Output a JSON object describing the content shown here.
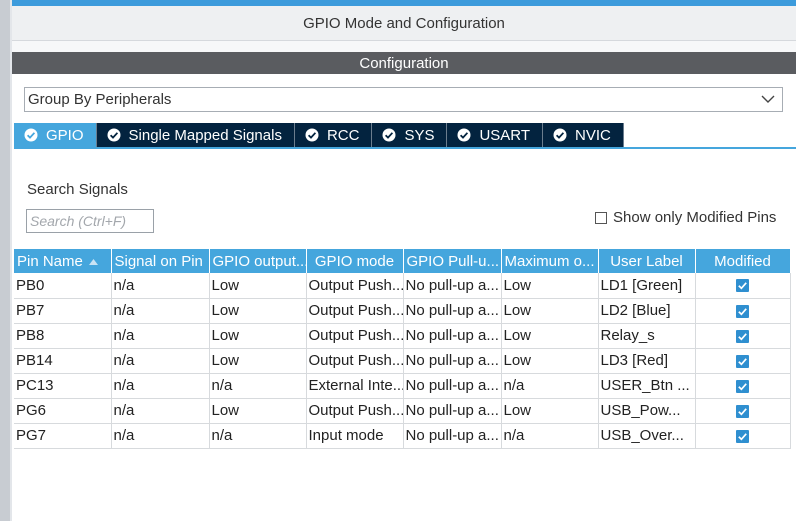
{
  "window": {
    "title": "GPIO Mode and Configuration"
  },
  "configuration": {
    "header": "Configuration",
    "group_select": {
      "value": "Group By Peripherals"
    }
  },
  "tabs": [
    {
      "label": "GPIO",
      "active": true
    },
    {
      "label": "Single Mapped Signals",
      "active": false
    },
    {
      "label": "RCC",
      "active": false
    },
    {
      "label": "SYS",
      "active": false
    },
    {
      "label": "USART",
      "active": false
    },
    {
      "label": "NVIC",
      "active": false
    }
  ],
  "search": {
    "label": "Search Signals",
    "placeholder": "Search (Ctrl+F)",
    "value": ""
  },
  "filter": {
    "label": "Show only Modified Pins",
    "checked": false
  },
  "table": {
    "columns": [
      "Pin Name",
      "Signal on Pin",
      "GPIO output...",
      "GPIO mode",
      "GPIO Pull-u...",
      "Maximum o...",
      "User Label",
      "Modified"
    ],
    "rows": [
      {
        "pin": "PB0",
        "signal": "n/a",
        "output": "Low",
        "mode": "Output Push...",
        "pull": "No pull-up a...",
        "speed": "Low",
        "label": "LD1 [Green]",
        "modified": true
      },
      {
        "pin": "PB7",
        "signal": "n/a",
        "output": "Low",
        "mode": "Output Push...",
        "pull": "No pull-up a...",
        "speed": "Low",
        "label": "LD2 [Blue]",
        "modified": true
      },
      {
        "pin": "PB8",
        "signal": "n/a",
        "output": "Low",
        "mode": "Output Push...",
        "pull": "No pull-up a...",
        "speed": "Low",
        "label": "Relay_s",
        "modified": true
      },
      {
        "pin": "PB14",
        "signal": "n/a",
        "output": "Low",
        "mode": "Output Push...",
        "pull": "No pull-up a...",
        "speed": "Low",
        "label": "LD3 [Red]",
        "modified": true
      },
      {
        "pin": "PC13",
        "signal": "n/a",
        "output": "n/a",
        "mode": "External Inte...",
        "pull": "No pull-up a...",
        "speed": "n/a",
        "label": "USER_Btn ...",
        "modified": true
      },
      {
        "pin": "PG6",
        "signal": "n/a",
        "output": "Low",
        "mode": "Output Push...",
        "pull": "No pull-up a...",
        "speed": "Low",
        "label": "USB_Pow...",
        "modified": true
      },
      {
        "pin": "PG7",
        "signal": "n/a",
        "output": "n/a",
        "mode": "Input mode",
        "pull": "No pull-up a...",
        "speed": "n/a",
        "label": "USB_Over...",
        "modified": true
      }
    ]
  },
  "colors": {
    "accent": "#45a6dd",
    "tab_inactive": "#03233f",
    "header_dark": "#5a5c60",
    "check": "#2f8fd0"
  },
  "icons": {
    "tab_check": "check-circle-icon",
    "dropdown": "chevron-down-icon",
    "sort": "sort-arrow-icon",
    "modified_check": "checkbox-checked-icon"
  }
}
